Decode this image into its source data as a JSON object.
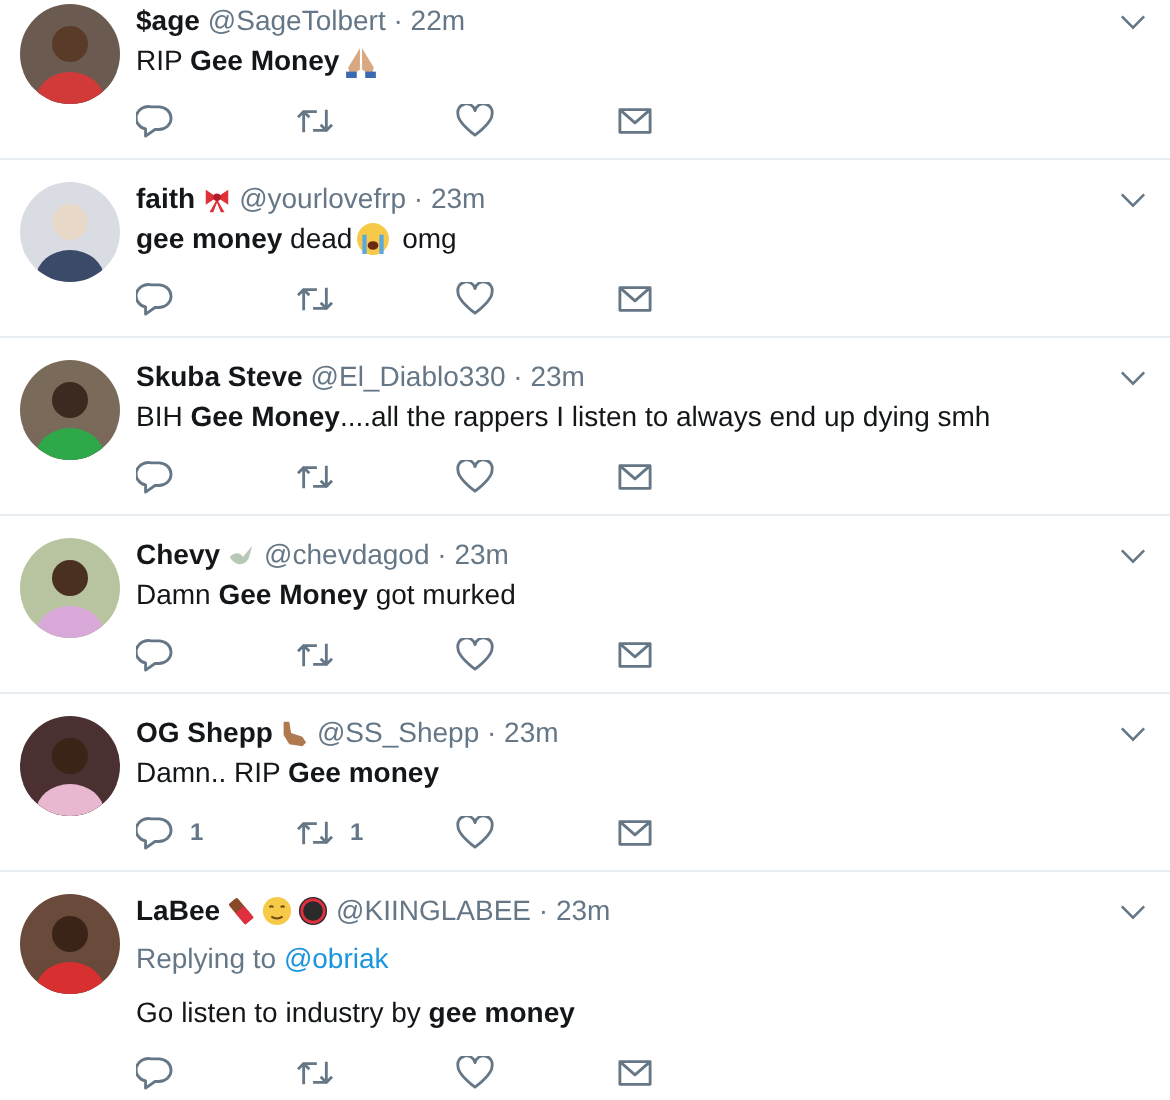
{
  "tweets": [
    {
      "name": "$age",
      "byline": "@SageTolbert · 22m",
      "body": [
        {
          "kind": "text",
          "text": "RIP **Gee Money**"
        },
        {
          "kind": "praying-hands"
        }
      ]
    },
    {
      "name": "faith",
      "badges": [
        {
          "kind": "ribbon"
        }
      ],
      "byline": "@yourlovefrp · 23m",
      "body": [
        {
          "kind": "text",
          "text": "**gee money** dead"
        },
        {
          "kind": "crying-face"
        },
        {
          "kind": "text",
          "text": " omg"
        }
      ]
    },
    {
      "name": "Skuba Steve",
      "byline": "@El_Diablo330 · 23m",
      "body": [
        {
          "kind": "text",
          "text": "BIH **Gee Money**....all the rappers I listen to always end up dying smh"
        }
      ]
    },
    {
      "name": "Chevy",
      "badges": [
        {
          "kind": "dove"
        }
      ],
      "byline": "@chevdagod · 23m",
      "body": [
        {
          "kind": "text",
          "text": "Damn **Gee Money** got murked"
        }
      ]
    },
    {
      "name": "OG Shepp",
      "badges": [
        {
          "kind": "call-me-hand"
        }
      ],
      "byline": "@SS_Shepp · 23m",
      "body": [
        {
          "kind": "text",
          "text": "Damn.. RIP **Gee money**"
        }
      ],
      "replies": "1",
      "retweets": "1"
    },
    {
      "name": "LaBee",
      "badges": [
        {
          "kind": "chocolate-bar"
        },
        {
          "kind": "drooling-face"
        },
        {
          "kind": "no-under-18"
        }
      ],
      "byline": "@KIINGLABEE · 23m",
      "reply_to": {
        "label": "Replying to",
        "user": "@obriak"
      },
      "body": [
        {
          "kind": "text",
          "text": "Go listen to industry by **gee money**"
        }
      ]
    }
  ]
}
